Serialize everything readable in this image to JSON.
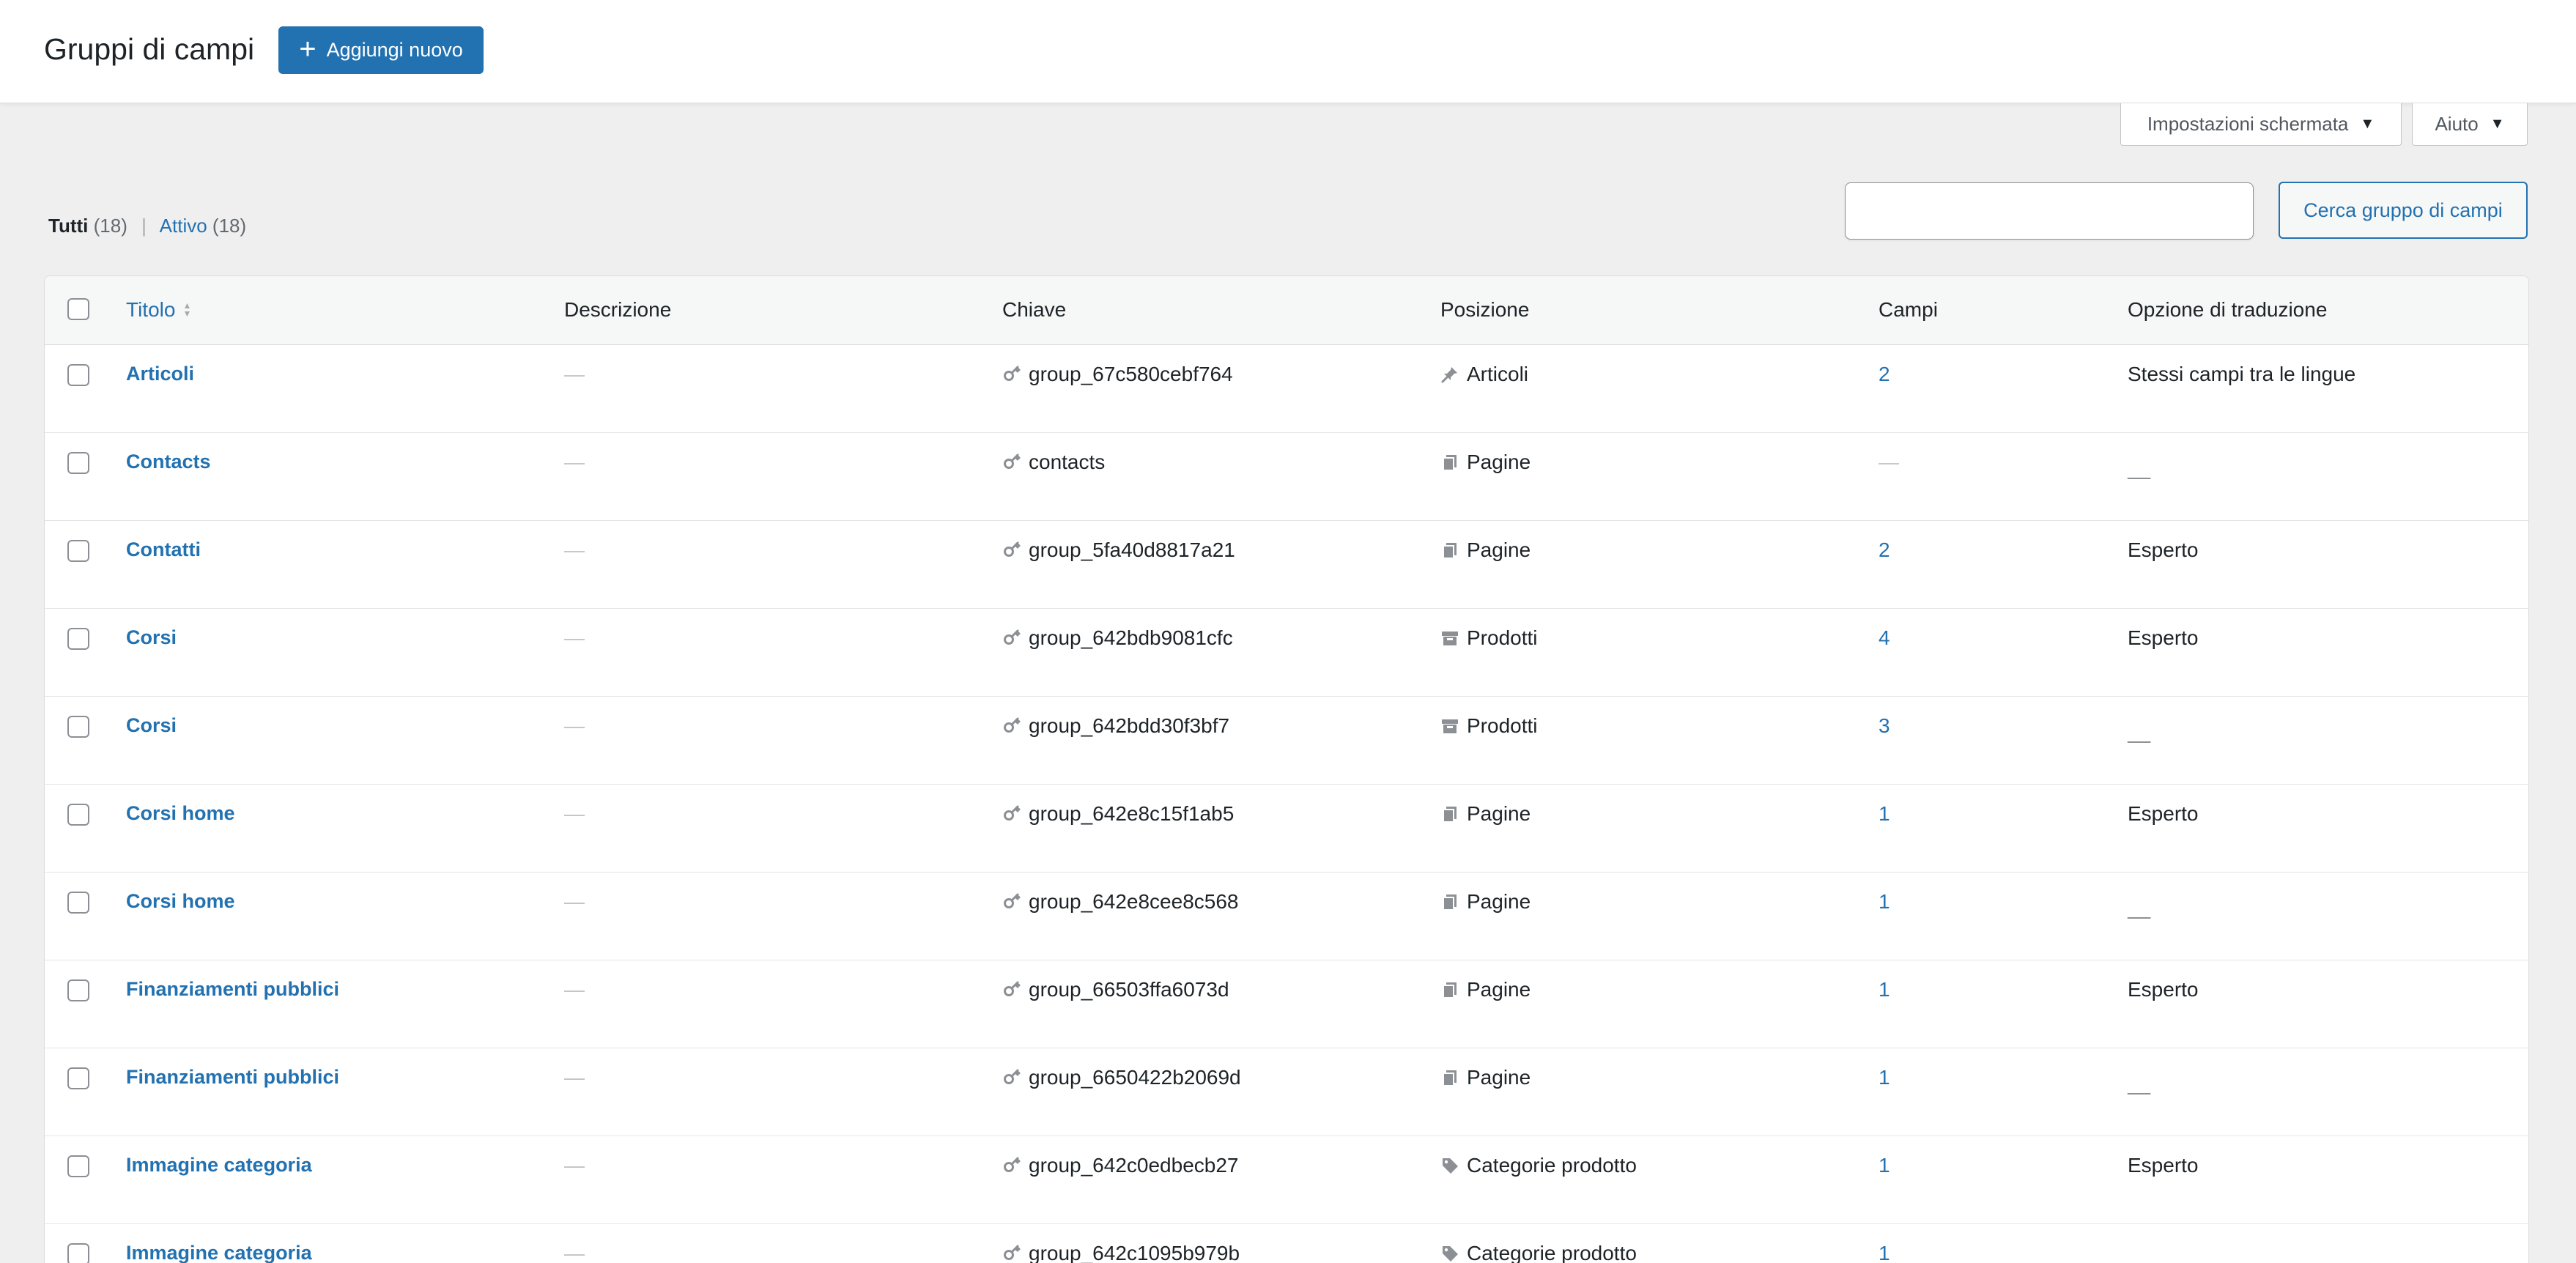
{
  "header": {
    "title": "Gruppi di campi",
    "add_new_label": "Aggiungi nuovo"
  },
  "screen_options_label": "Impostazioni schermata",
  "help_label": "Aiuto",
  "filters": {
    "all_label": "Tutti",
    "all_count": "(18)",
    "active_label": "Attivo",
    "active_count": "(18)",
    "separator": "|"
  },
  "search": {
    "value": "",
    "button_label": "Cerca gruppo di campi"
  },
  "table": {
    "columns": {
      "title": "Titolo",
      "description": "Descrizione",
      "key": "Chiave",
      "location": "Posizione",
      "fields": "Campi",
      "translation": "Opzione di traduzione"
    },
    "rows": [
      {
        "title": "Articoli",
        "description": "—",
        "key": "group_67c580cebf764",
        "location": "Articoli",
        "location_icon": "pin-icon",
        "fields": "2",
        "translation": "Stessi campi tra le lingue"
      },
      {
        "title": "Contacts",
        "description": "—",
        "key": "contacts",
        "location": "Pagine",
        "location_icon": "page-icon",
        "fields": "—",
        "translation": "__"
      },
      {
        "title": "Contatti",
        "description": "—",
        "key": "group_5fa40d8817a21",
        "location": "Pagine",
        "location_icon": "page-icon",
        "fields": "2",
        "translation": "Esperto"
      },
      {
        "title": "Corsi",
        "description": "—",
        "key": "group_642bdb9081cfc",
        "location": "Prodotti",
        "location_icon": "archive-icon",
        "fields": "4",
        "translation": "Esperto"
      },
      {
        "title": "Corsi",
        "description": "—",
        "key": "group_642bdd30f3bf7",
        "location": "Prodotti",
        "location_icon": "archive-icon",
        "fields": "3",
        "translation": "__"
      },
      {
        "title": "Corsi home",
        "description": "—",
        "key": "group_642e8c15f1ab5",
        "location": "Pagine",
        "location_icon": "page-icon",
        "fields": "1",
        "translation": "Esperto"
      },
      {
        "title": "Corsi home",
        "description": "—",
        "key": "group_642e8cee8c568",
        "location": "Pagine",
        "location_icon": "page-icon",
        "fields": "1",
        "translation": "__"
      },
      {
        "title": "Finanziamenti pubblici",
        "description": "—",
        "key": "group_66503ffa6073d",
        "location": "Pagine",
        "location_icon": "page-icon",
        "fields": "1",
        "translation": "Esperto"
      },
      {
        "title": "Finanziamenti pubblici",
        "description": "—",
        "key": "group_6650422b2069d",
        "location": "Pagine",
        "location_icon": "page-icon",
        "fields": "1",
        "translation": "__"
      },
      {
        "title": "Immagine categoria",
        "description": "—",
        "key": "group_642c0edbecb27",
        "location": "Categorie prodotto",
        "location_icon": "tag-icon",
        "fields": "1",
        "translation": "Esperto"
      },
      {
        "title": "Immagine categoria",
        "description": "—",
        "key": "group_642c1095b979b",
        "location": "Categorie prodotto",
        "location_icon": "tag-icon",
        "fields": "1",
        "translation": ""
      }
    ]
  },
  "colors": {
    "accent": "#2271b1",
    "background": "#efefef",
    "text": "#1d2327"
  }
}
